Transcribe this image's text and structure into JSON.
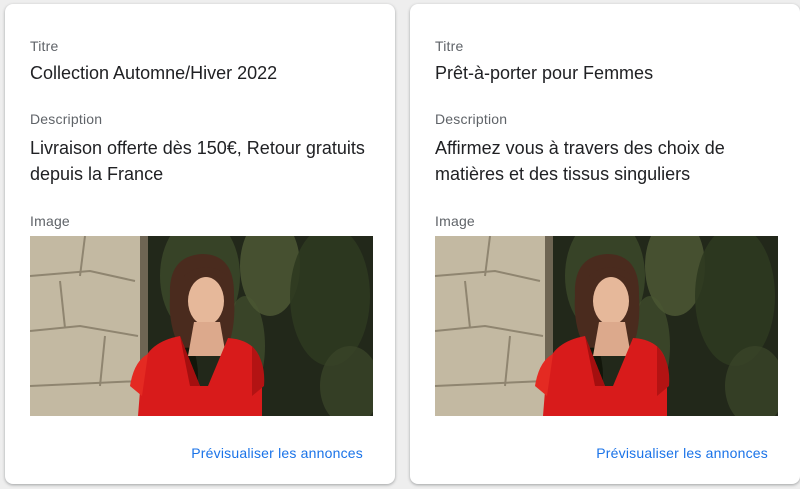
{
  "cards": [
    {
      "title_label": "Titre",
      "title_value": "Collection Automne/Hiver 2022",
      "description_label": "Description",
      "description_value": "Livraison offerte dès 150€, Retour gratuits depuis la France",
      "image_label": "Image",
      "preview_link": "Prévisualiser les annonces"
    },
    {
      "title_label": "Titre",
      "title_value": "Prêt-à-porter pour Femmes",
      "description_label": "Description",
      "description_value": "Affirmez vous à travers des choix de matières et des tissus singuliers",
      "image_label": "Image",
      "preview_link": "Prévisualiser les annonces"
    }
  ],
  "colors": {
    "link": "#1a73e8",
    "label": "#5f6368",
    "text": "#202124"
  }
}
